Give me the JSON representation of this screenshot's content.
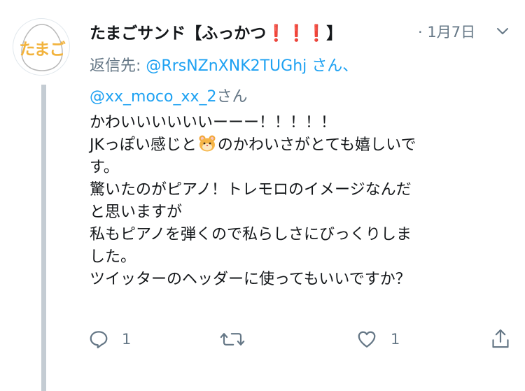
{
  "avatar": {
    "text": "たまご"
  },
  "tweet": {
    "display_name": "たまごサンド【ふっかつ❗❗❗】",
    "time": "· 1月7日",
    "reply_prefix": "返信先: ",
    "reply_user_1": "@RrsNZnXNK2TUGhj",
    "reply_suffix_1": " さん、",
    "reply_user_2": "@xx_moco_xx_2",
    "reply_suffix_2": "さん",
    "body_lines": [
      "かわいいいいいいーーー！！！！！",
      "JKっぽい感じと",
      "のかわいさがとても嬉しいで",
      "す。",
      "驚いたのがピアノ！トレモロのイメージなんだ",
      "と思いますが",
      "私もピアノを弾くので私らしさにびっくりしま",
      "した。",
      "ツイッターのヘッダーに使ってもいいですか？"
    ]
  },
  "actions": {
    "reply_count": "1",
    "retweet_count": "",
    "like_count": "1"
  },
  "colors": {
    "link": "#1da1f2",
    "secondary": "#657786",
    "thread_line": "#c4ccd3",
    "avatar_text": "#f2b33d"
  },
  "icons": [
    "reply-icon",
    "retweet-icon",
    "like-icon",
    "share-icon",
    "chevron-down-icon",
    "hamster-emoji"
  ]
}
